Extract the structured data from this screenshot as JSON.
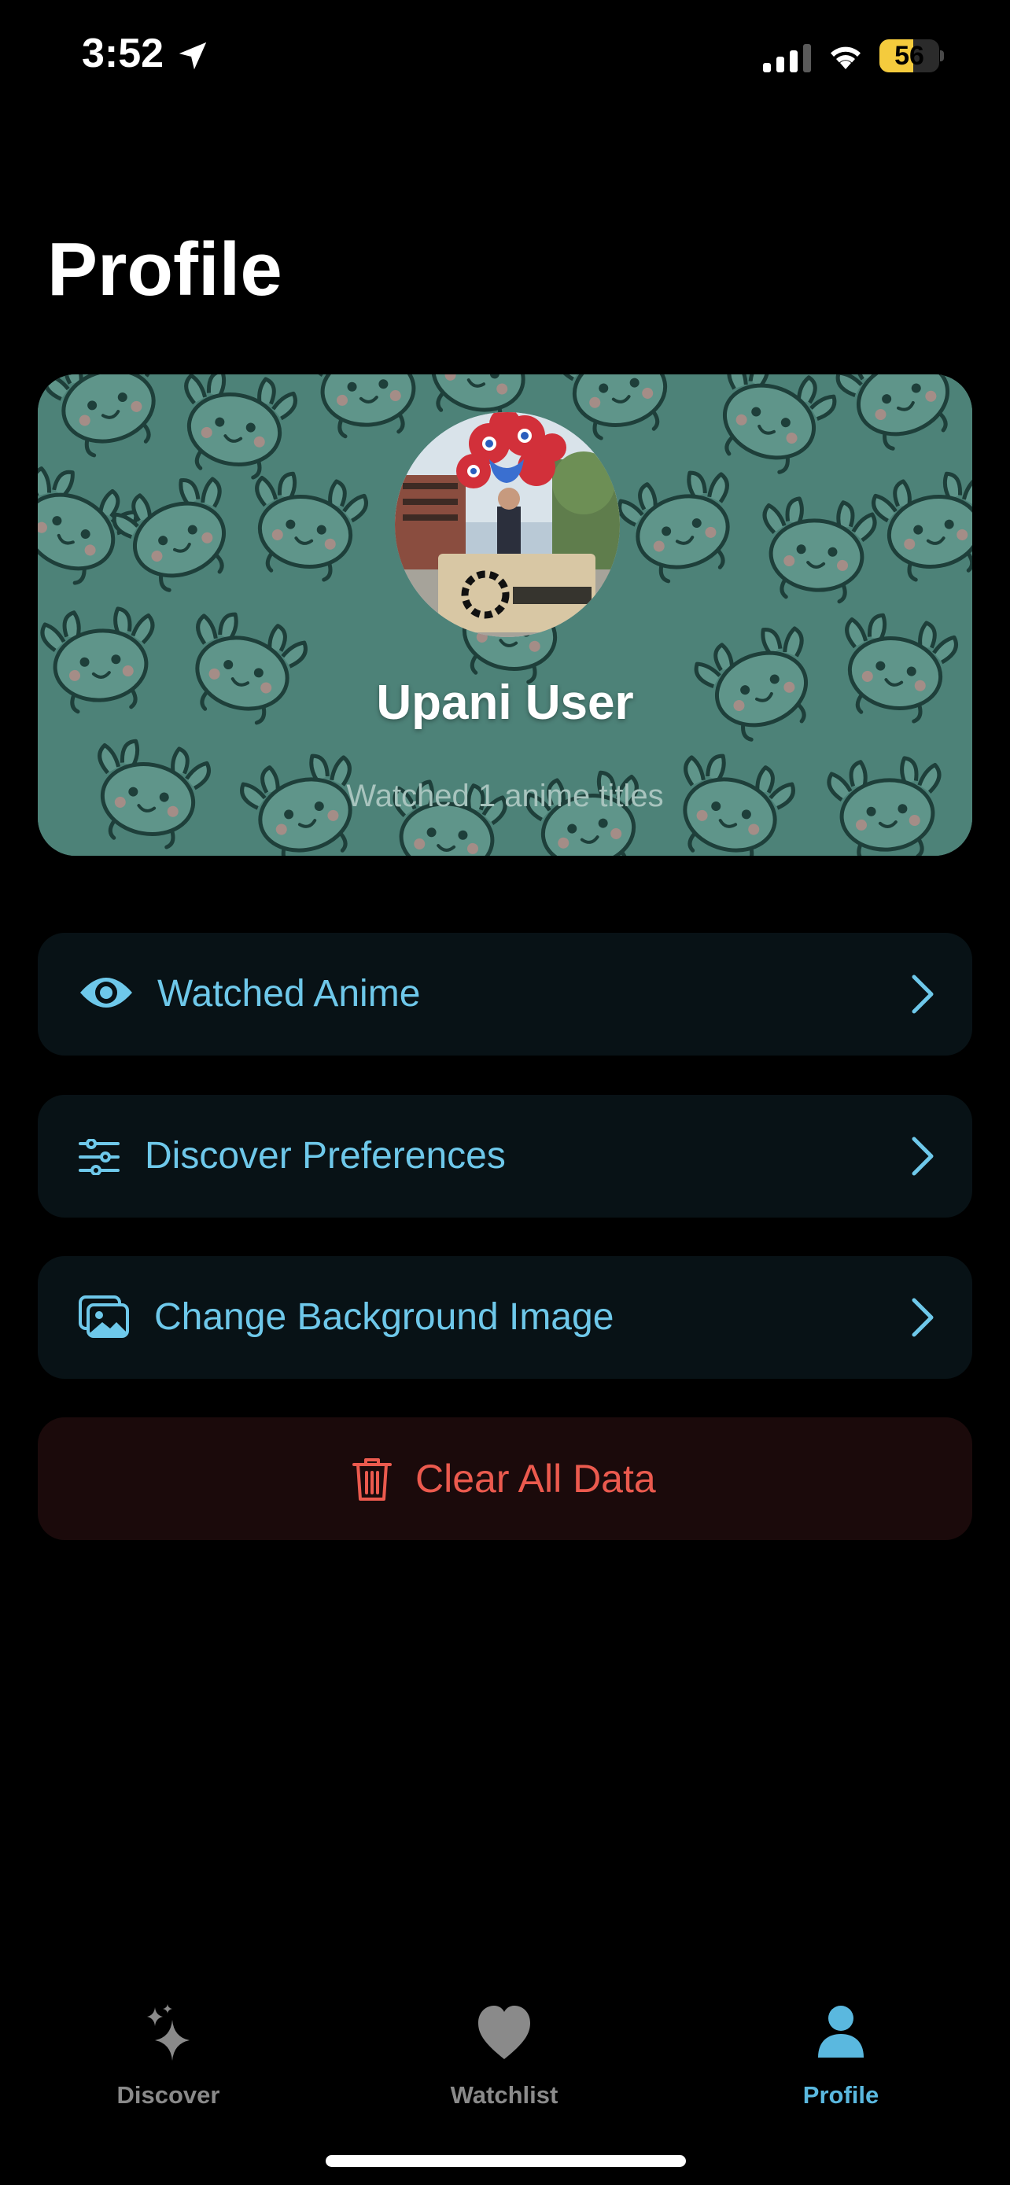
{
  "status_bar": {
    "time": "3:52",
    "battery_level": "56",
    "battery_fraction": 0.56,
    "battery_color": "#f4cb3d"
  },
  "page": {
    "title": "Profile"
  },
  "profile_card": {
    "name": "Upani User",
    "stats": "Watched 1 anime titles",
    "background_color": "#4d8278"
  },
  "menu": {
    "watched_anime": {
      "label": "Watched Anime",
      "icon": "eye-icon"
    },
    "discover_preferences": {
      "label": "Discover Preferences",
      "icon": "sliders-icon"
    },
    "change_background": {
      "label": "Change Background Image",
      "icon": "photos-icon"
    },
    "clear_data": {
      "label": "Clear All Data",
      "icon": "trash-icon"
    }
  },
  "colors": {
    "accent": "#5ab8df",
    "menu_text": "#6ec8ea",
    "danger": "#eb5a4e",
    "row_background": "#081216",
    "danger_background": "#1b0a0b"
  },
  "tabs": [
    {
      "label": "Discover",
      "icon": "sparkles-icon",
      "active": false
    },
    {
      "label": "Watchlist",
      "icon": "heart-icon",
      "active": false
    },
    {
      "label": "Profile",
      "icon": "person-icon",
      "active": true
    }
  ]
}
